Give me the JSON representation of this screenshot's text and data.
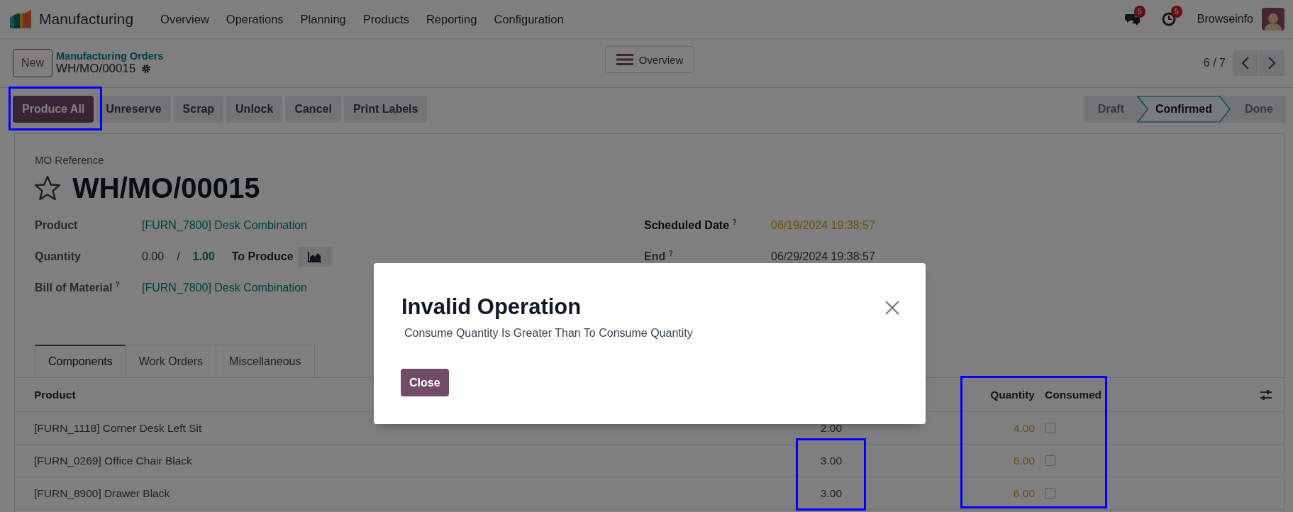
{
  "navbar": {
    "app_name": "Manufacturing",
    "menu": [
      "Overview",
      "Operations",
      "Planning",
      "Products",
      "Reporting",
      "Configuration"
    ],
    "messages_badge": "5",
    "activities_badge": "5",
    "user": "Browseinfo"
  },
  "control_panel": {
    "new_button": "New",
    "breadcrumb": "Manufacturing Orders",
    "record": "WH/MO/00015",
    "view_button": "Overview",
    "pager": "6 / 7"
  },
  "actions": [
    {
      "label": "Produce All",
      "primary": true,
      "highlighted": true
    },
    {
      "label": "Unreserve",
      "primary": false,
      "highlighted": false
    },
    {
      "label": "Scrap",
      "primary": false,
      "highlighted": false
    },
    {
      "label": "Unlock",
      "primary": false,
      "highlighted": false
    },
    {
      "label": "Cancel",
      "primary": false,
      "highlighted": false
    },
    {
      "label": "Print Labels",
      "primary": false,
      "highlighted": false
    }
  ],
  "stages": [
    {
      "label": "Draft",
      "selected": false
    },
    {
      "label": "Confirmed",
      "selected": true
    },
    {
      "label": "Done",
      "selected": false
    }
  ],
  "form": {
    "reference_label": "MO Reference",
    "starred": false,
    "title": "WH/MO/00015",
    "left_fields": [
      {
        "kind": "link",
        "label": "Product",
        "value": "[FURN_7800] Desk Combination"
      },
      {
        "kind": "quantity",
        "label": "Quantity",
        "produced": "0.00",
        "separator": "/",
        "planned": "1.00",
        "suffix": "To Produce"
      },
      {
        "kind": "link",
        "label": "Bill of Material",
        "help": "?",
        "value": "[FURN_7800] Desk Combination"
      }
    ],
    "right_fields": [
      {
        "kind": "warning",
        "label": "Scheduled Date",
        "help": "?",
        "value": "06/19/2024 19:38:57"
      },
      {
        "kind": "plain",
        "label": "End",
        "help": "?",
        "value": "06/29/2024 19:38:57"
      }
    ]
  },
  "tabs": [
    {
      "label": "Components",
      "selected": true
    },
    {
      "label": "Work Orders",
      "selected": false
    },
    {
      "label": "Miscellaneous",
      "selected": false
    }
  ],
  "table": {
    "headers": {
      "product": "Product",
      "quantity": "Quantity",
      "consumed": "Consumed"
    },
    "quantity_consumed_highlighted": true,
    "rows": [
      {
        "product": "[FURN_1118] Corner Desk Left Sit",
        "column_2": "2.00",
        "column_2_highlighted": false,
        "quantity": "4.00",
        "consumed": false
      },
      {
        "product": "[FURN_0269] Office Chair Black",
        "column_2": "3.00",
        "column_2_highlighted": true,
        "quantity": "6.00",
        "consumed": false
      },
      {
        "product": "[FURN_8900] Drawer Black",
        "column_2": "3.00",
        "column_2_highlighted": true,
        "quantity": "6.00",
        "consumed": false
      }
    ]
  },
  "dialog": {
    "title": "Invalid Operation",
    "message": "Consume Quantity Is Greater Than To Consume Quantity",
    "button": "Close"
  }
}
